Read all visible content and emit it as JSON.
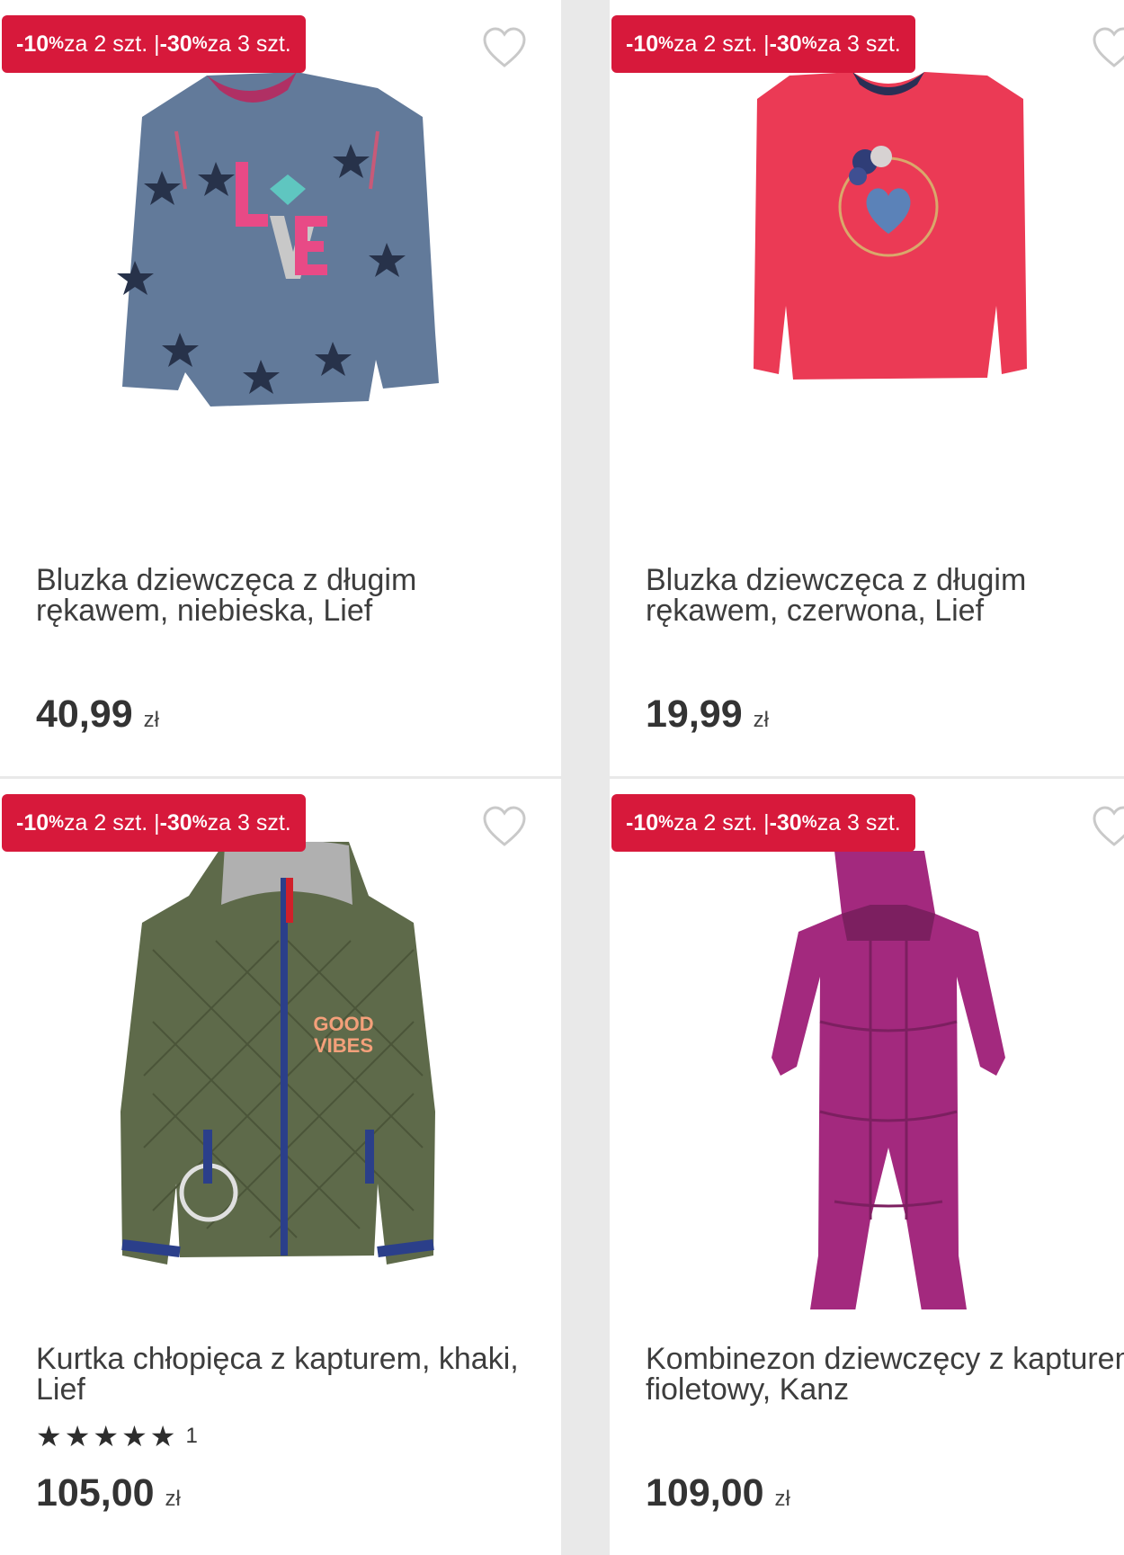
{
  "products": [
    {
      "promo": {
        "part1": "-10",
        "pct1": "%",
        "part2": " za 2 szt. | ",
        "part3": "-30",
        "pct2": "%",
        "part4": " za 3 szt."
      },
      "title": "Bluzka dziewczęca z długim rękawem, niebieska, Lief",
      "price": "40,99",
      "currency": "zł",
      "image_name": "blue-star-sweatshirt"
    },
    {
      "promo": {
        "part1": "-10",
        "pct1": "%",
        "part2": " za 2 szt. | ",
        "part3": "-30",
        "pct2": "%",
        "part4": " za 3 szt."
      },
      "title": "Bluzka dziewczęca z długim rękawem, czerwona, Lief",
      "price": "19,99",
      "currency": "zł",
      "image_name": "red-heart-top"
    },
    {
      "promo": {
        "part1": "-10",
        "pct1": "%",
        "part2": " za 2 szt. | ",
        "part3": "-30",
        "pct2": "%",
        "part4": " za 3 szt."
      },
      "title": "Kurtka chłopięca z kapturem, khaki, Lief",
      "rating": {
        "stars": "★★★★★",
        "count": "1",
        "value": 5,
        "max": 5
      },
      "price": "105,00",
      "currency": "zł",
      "image_name": "khaki-quilted-jacket"
    },
    {
      "promo": {
        "part1": "-10",
        "pct1": "%",
        "part2": " za 2 szt. | ",
        "part3": "-30",
        "pct2": "%",
        "part4": " za 3 szt."
      },
      "title": "Kombinezon dziewczęcy z kapturem, fioletowy, Kanz",
      "price": "109,00",
      "currency": "zł",
      "image_name": "purple-quilted-snowsuit"
    }
  ],
  "colors": {
    "badge": "#d7193b",
    "background": "#e9e9e9"
  },
  "icons": {
    "favorite": "heart-outline-icon",
    "rating": "star-icon"
  }
}
